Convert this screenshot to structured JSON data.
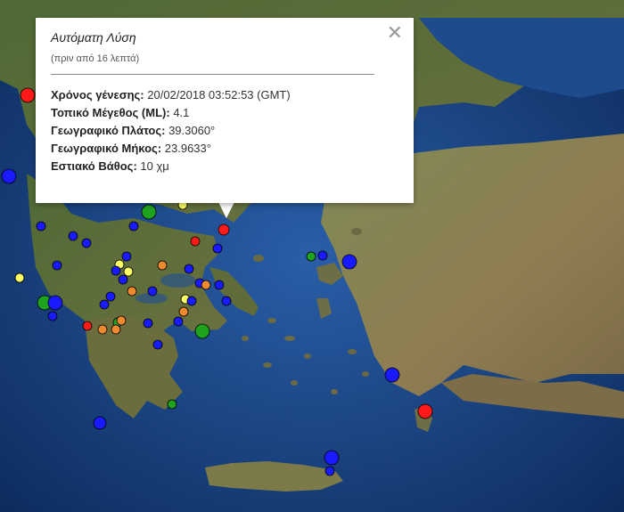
{
  "popup": {
    "title": "Αυτόματη Λύση",
    "subtitle": "(πριν από 16 λεπτά)",
    "close_icon": "close-icon",
    "rows": [
      {
        "label": "Χρόνος γένεσης:",
        "value": "20/02/2018   03:52:53 (GMT)"
      },
      {
        "label": "Τοπικό Μέγεθος (ML):",
        "value": "4.1"
      },
      {
        "label": "Γεωγραφικό Πλάτος:",
        "value": "39.3060°"
      },
      {
        "label": "Γεωγραφικό Μήκος:",
        "value": "23.9633°"
      },
      {
        "label": "Εστιακό Βάθος:",
        "value": "10 χμ"
      }
    ]
  },
  "legend_colors": {
    "red": "#ff1a1a",
    "orange": "#f08a30",
    "yellow": "#ffff66",
    "green": "#1fa31f",
    "blue": "#1a1aff"
  },
  "map_colors": {
    "sea": "#1b3f7a",
    "deep_sea": "#0e2f63",
    "land": "#8a7e4f",
    "land_green": "#5b6d3a"
  }
}
